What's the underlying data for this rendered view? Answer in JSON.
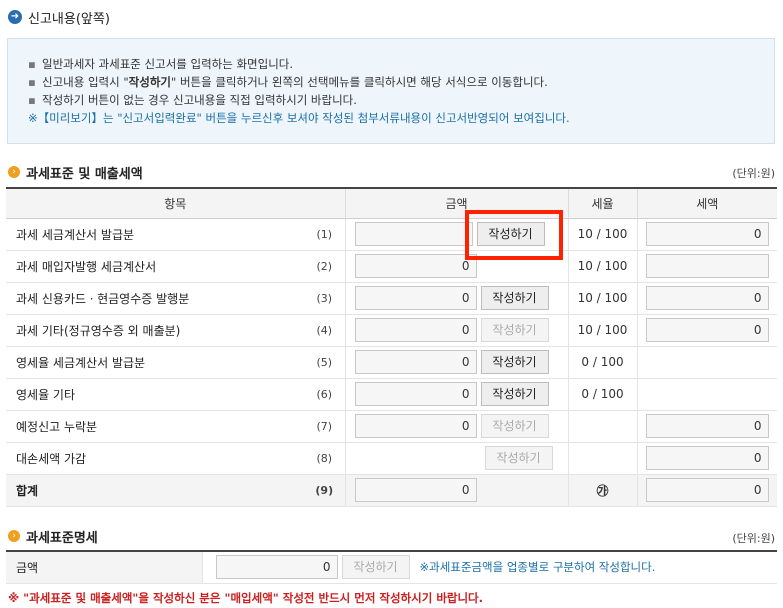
{
  "page": {
    "title": "신고내용(앞쪽)"
  },
  "info": {
    "lines": [
      "일반과세자 과세표준 신고서를 입력하는 화면입니다.",
      "버튼을 클릭하거나 왼쪽의 선택메뉴를 클릭하시면 해당 서식으로 이동합니다.",
      "작성하기 버튼이 없는 경우 신고내용을 직접 입력하시기 바랍니다."
    ],
    "line2_prefix": "신고내용 입력시 \"",
    "line2_bold": "작성하기",
    "note": "※【미리보기】는 \"신고서입력완료\" 버튼을 누르신후 보셔야 작성된 첨부서류내용이 신고서반영되어 보여집니다."
  },
  "section1": {
    "title": "과세표준 및 매출세액",
    "unit": "(단위:원)",
    "headers": {
      "item": "항목",
      "amount": "금액",
      "rate": "세율",
      "tax": "세액"
    },
    "rows": [
      {
        "name": "과세 세금계산서 발급분",
        "num": "(1)",
        "amount": "",
        "button": "작성하기",
        "rate": "10 / 100",
        "tax": "0"
      },
      {
        "name": "과세 매입자발행 세금계산서",
        "num": "(2)",
        "amount": "0",
        "rate": "10 / 100",
        "tax": ""
      },
      {
        "name": "과세 신용카드ㆍ현금영수증 발행분",
        "num": "(3)",
        "amount": "0",
        "button": "작성하기",
        "rate": "10 / 100",
        "tax": "0"
      },
      {
        "name": "과세 기타(정규영수증 외 매출분)",
        "num": "(4)",
        "amount": "0",
        "button": "작성하기",
        "rate": "10 / 100",
        "tax": "0"
      },
      {
        "name": "영세율 세금계산서 발급분",
        "num": "(5)",
        "amount": "0",
        "button": "작성하기",
        "rate": "0 / 100"
      },
      {
        "name": "영세율 기타",
        "num": "(6)",
        "amount": "0",
        "button": "작성하기",
        "rate": "0 / 100"
      },
      {
        "name": "예정신고 누락분",
        "num": "(7)",
        "amount": "0",
        "button": "작성하기",
        "tax": "0"
      },
      {
        "name": "대손세액 가감",
        "num": "(8)",
        "button": "작성하기",
        "tax": "0"
      }
    ],
    "total": {
      "name": "합계",
      "num": "(9)",
      "amount": "0",
      "rate": "㉮",
      "tax": "0"
    }
  },
  "section2": {
    "title": "과세표준명세",
    "unit": "(단위:원)",
    "row": {
      "name": "금액",
      "amount": "0",
      "button": "작성하기",
      "hint": "※과세표준금액을 업종별로 구분하여 작성합니다."
    }
  },
  "bottom_note": "※ \"과세표준 및 매출세액\"을 작성하신 분은 \"매입세액\" 작성전 반드시 먼저 작성하시기 바랍니다.",
  "colors": {
    "accent_blue": "#2b6cb0",
    "section_orange": "#f0a020",
    "highlight_red": "#ff2200",
    "note_blue": "#1b6fa8",
    "warning_red": "#cc1f1f"
  }
}
